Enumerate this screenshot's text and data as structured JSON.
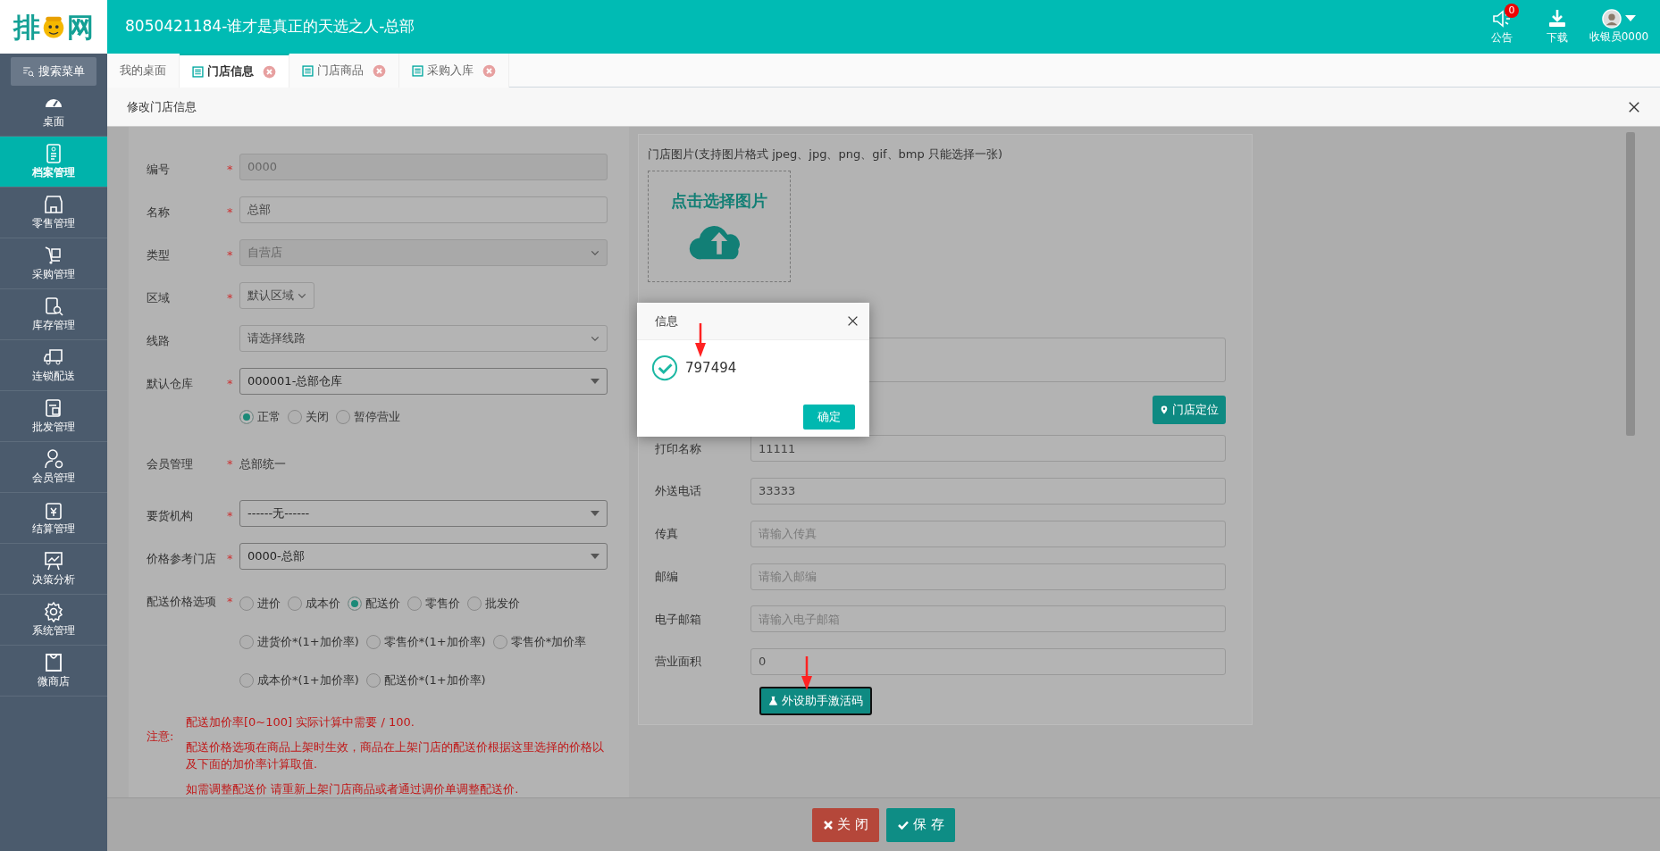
{
  "logo": {
    "left": "排",
    "right": "网"
  },
  "header": {
    "title": "8050421184-谁才是真正的天选之人-总部",
    "actions": [
      {
        "kind": "notice",
        "label": "公告",
        "badge": "0"
      },
      {
        "kind": "download",
        "label": "下载"
      },
      {
        "kind": "user",
        "label": "收银员0000"
      }
    ]
  },
  "sidebar": {
    "search": "搜索菜单",
    "items": [
      {
        "label": "桌面",
        "selected": false
      },
      {
        "label": "档案管理",
        "selected": true
      },
      {
        "label": "零售管理",
        "selected": false
      },
      {
        "label": "采购管理",
        "selected": false
      },
      {
        "label": "库存管理",
        "selected": false
      },
      {
        "label": "连锁配送",
        "selected": false
      },
      {
        "label": "批发管理",
        "selected": false
      },
      {
        "label": "会员管理",
        "selected": false
      },
      {
        "label": "结算管理",
        "selected": false
      },
      {
        "label": "决策分析",
        "selected": false
      },
      {
        "label": "系统管理",
        "selected": false
      },
      {
        "label": "微商店",
        "selected": false
      }
    ]
  },
  "tabs": [
    {
      "kind": "home",
      "label": "我的桌面",
      "selected": false
    },
    {
      "kind": "page",
      "label": "门店信息",
      "selected": true
    },
    {
      "kind": "page",
      "label": "门店商品",
      "selected": false
    },
    {
      "kind": "page",
      "label": "采购入库",
      "selected": false
    }
  ],
  "page_title": "修改门店信息",
  "form_left": [
    {
      "kind": "input",
      "label": "编号",
      "required_mark": "*",
      "value": "0000",
      "disabled": true
    },
    {
      "kind": "input",
      "label": "名称",
      "required_mark": "*",
      "value": "总部",
      "disabled": false
    },
    {
      "kind": "select",
      "label": "类型",
      "required_mark": "*",
      "value": "自营店",
      "disabled": true
    },
    {
      "kind": "select-small",
      "label": "区域",
      "required_mark": "*",
      "value": "默认区域",
      "disabled": false
    },
    {
      "kind": "select",
      "label": "线路",
      "value": "请选择线路",
      "disabled": false
    },
    {
      "kind": "combo",
      "label": "默认仓库",
      "required_mark": "*",
      "value": "000001-总部仓库"
    },
    {
      "kind": "radios",
      "option_rows": [
        [
          {
            "label": "正常",
            "selected": true
          },
          {
            "label": "关闭",
            "selected": false
          },
          {
            "label": "暂停营业",
            "selected": false
          }
        ]
      ]
    },
    {
      "kind": "static",
      "label": "会员管理",
      "required_mark": "*",
      "value": "总部统一"
    },
    {
      "kind": "combo",
      "label": "要货机构",
      "required_mark": "*",
      "value": "------无------"
    },
    {
      "kind": "combo",
      "label": "价格参考门店",
      "required_mark": "*",
      "value": "0000-总部"
    },
    {
      "kind": "radios",
      "label": "配送价格选项",
      "required_mark": "*",
      "option_rows": [
        [
          {
            "label": "进价",
            "selected": false
          },
          {
            "label": "成本价",
            "selected": false
          },
          {
            "label": "配送价",
            "selected": true
          },
          {
            "label": "零售价",
            "selected": false
          },
          {
            "label": "批发价",
            "selected": false
          }
        ],
        [
          {
            "label": "进货价*(1+加价率)",
            "selected": false
          },
          {
            "label": "零售价*(1+加价率)",
            "selected": false
          },
          {
            "label": "零售价*加价率",
            "selected": false
          }
        ],
        [
          {
            "label": "成本价*(1+加价率)",
            "selected": false
          },
          {
            "label": "配送价*(1+加价率)",
            "selected": false
          }
        ]
      ]
    }
  ],
  "notes": {
    "label": "注意:",
    "lines": [
      "配送加价率[0~100] 实际计算中需要 / 100.",
      "配送价格选项在商品上架时生效，商品在上架门店的配送价根据这里选择的价格以及下面的加价率计算取值.",
      "如需调整配送价 请重新上架门店商品或者通过调价单调整配送价."
    ]
  },
  "image": {
    "label": "门店图片(支持图片格式 jpeg、jpg、png、gif、bmp 只能选择一张)",
    "upload": "点击选择图片"
  },
  "locate_button": "门店定位",
  "form_right": [
    {
      "label": "打印名称",
      "value": "11111"
    },
    {
      "label": "外送电话",
      "value": "33333"
    },
    {
      "label": "传真",
      "placeholder": "请输入传真"
    },
    {
      "label": "邮编",
      "placeholder": "请输入邮编"
    },
    {
      "label": "电子邮箱",
      "placeholder": "请输入电子邮箱"
    },
    {
      "label": "营业面积",
      "value": "0"
    }
  ],
  "activate_button": "外设助手激活码",
  "footer": [
    {
      "kind": "close",
      "label": "关 闭"
    },
    {
      "kind": "save",
      "label": "保 存"
    }
  ],
  "dialog": {
    "title": "信息",
    "message": "797494",
    "button": "确定"
  }
}
